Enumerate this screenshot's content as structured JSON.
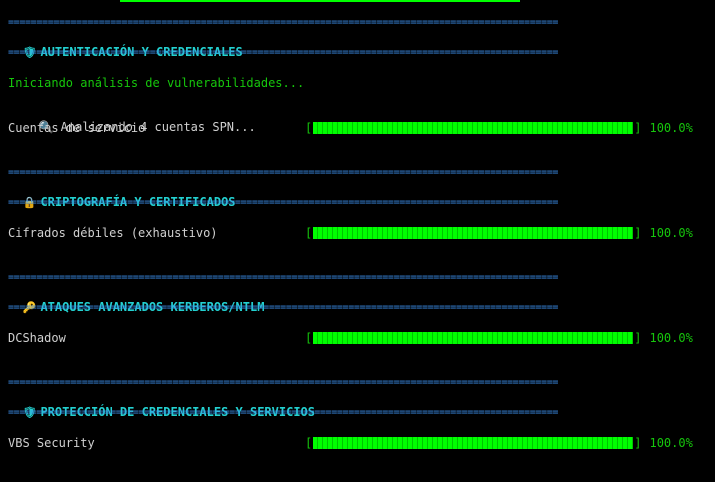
{
  "rule": "=================================================================================================",
  "sections": [
    {
      "icon": "shield-icon",
      "glyph": "🛡",
      "title": "AUTENTICACIÓN Y CREDENCIALES"
    },
    {
      "icon": "lock-icon",
      "glyph": "🔒",
      "title": "CRIPTOGRAFÍA Y CERTIFICADOS"
    },
    {
      "icon": "key-icon",
      "glyph": "🔑",
      "title": "ATAQUES AVANZADOS KERBEROS/NTLM"
    },
    {
      "icon": "shield-icon",
      "glyph": "🛡",
      "title": "PROTECCIÓN DE CREDENCIALES Y SERVICIOS"
    }
  ],
  "intro": "Iniciando análisis de vulnerabilidades...",
  "spn_line": {
    "icon": "magnifier-icon",
    "glyph": "🔍",
    "text": "Analizando 4 cuentas SPN..."
  },
  "tasks": [
    {
      "label": "Cuentas de servicio",
      "progress": 1.0,
      "percent_text": "100.0%"
    },
    {
      "label": "Cifrados débiles (exhaustivo)",
      "progress": 1.0,
      "percent_text": "100.0%"
    },
    {
      "label": "DCShadow",
      "progress": 1.0,
      "percent_text": "100.0%"
    },
    {
      "label": "VBS Security",
      "progress": 1.0,
      "percent_text": "100.0%"
    }
  ],
  "bracket_open": "[",
  "bracket_close": "]",
  "colors": {
    "rule": "#3b8eea",
    "heading": "#23d1d1",
    "bar": "#00ff00",
    "percent": "#16c60c"
  }
}
